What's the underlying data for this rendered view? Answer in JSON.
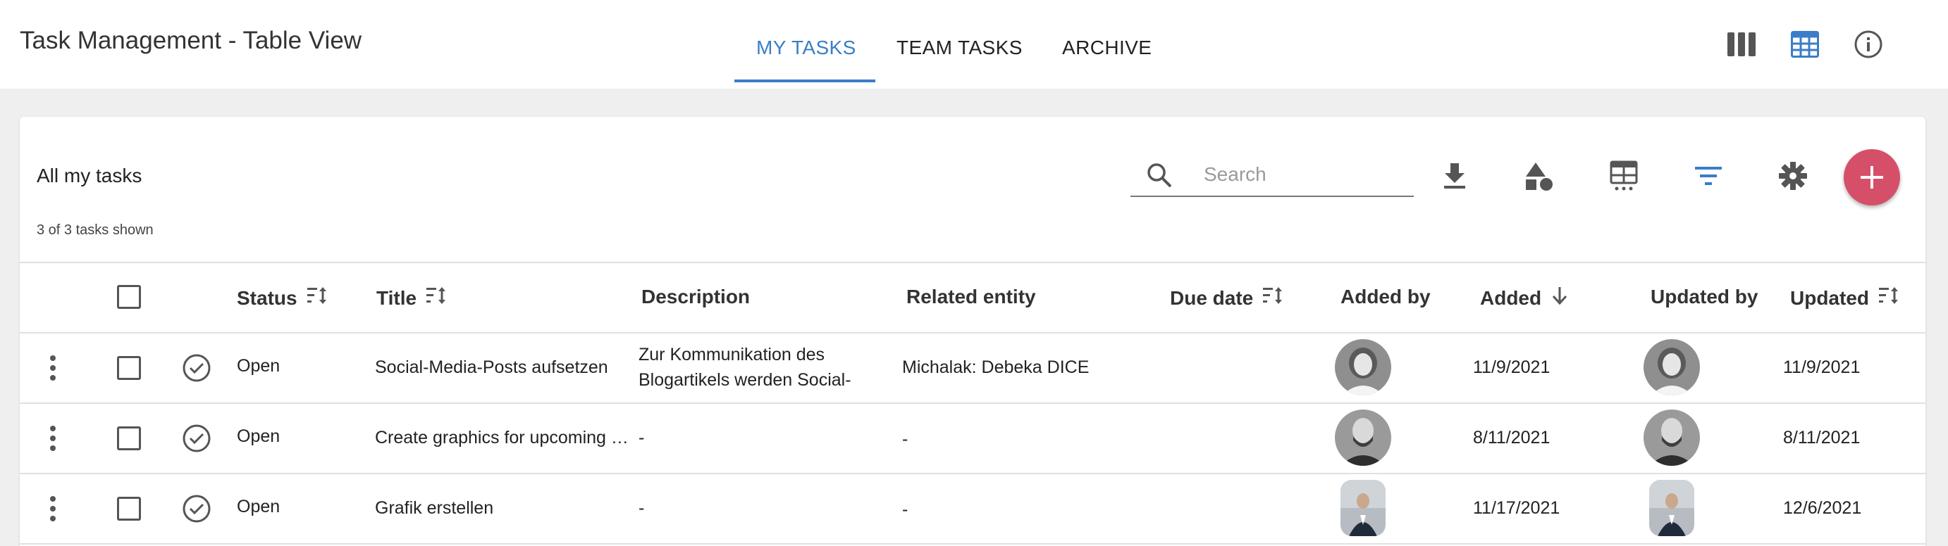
{
  "app": {
    "title": "Task Management - Table View"
  },
  "tabs": [
    {
      "label": "MY TASKS",
      "active": true
    },
    {
      "label": "TEAM TASKS",
      "active": false
    },
    {
      "label": "ARCHIVE",
      "active": false
    }
  ],
  "card": {
    "title": "All my tasks",
    "count_text": "3 of 3 tasks shown",
    "search_placeholder": "Search"
  },
  "colors": {
    "accent": "#3b7dc8",
    "fab": "#d64f69"
  },
  "columns": {
    "status": "Status",
    "title": "Title",
    "description": "Description",
    "related": "Related entity",
    "due": "Due date",
    "added_by": "Added by",
    "added": "Added",
    "updated_by": "Updated by",
    "updated": "Updated"
  },
  "rows": [
    {
      "status": "Open",
      "title": "Social-Media-Posts aufsetzen",
      "description": "Zur Kommunikation des Blogartikels werden Social-Media-Posts erstellt",
      "related": "Michalak: Debeka DICE",
      "due": "",
      "added": "11/9/2021",
      "updated": "11/9/2021"
    },
    {
      "status": "Open",
      "title": "Create graphics for upcoming campaign",
      "description": "-",
      "related": "-",
      "due": "",
      "added": "8/11/2021",
      "updated": "8/11/2021"
    },
    {
      "status": "Open",
      "title": "Grafik erstellen",
      "description": "-",
      "related": "-",
      "due": "",
      "added": "11/17/2021",
      "updated": "12/6/2021"
    }
  ]
}
